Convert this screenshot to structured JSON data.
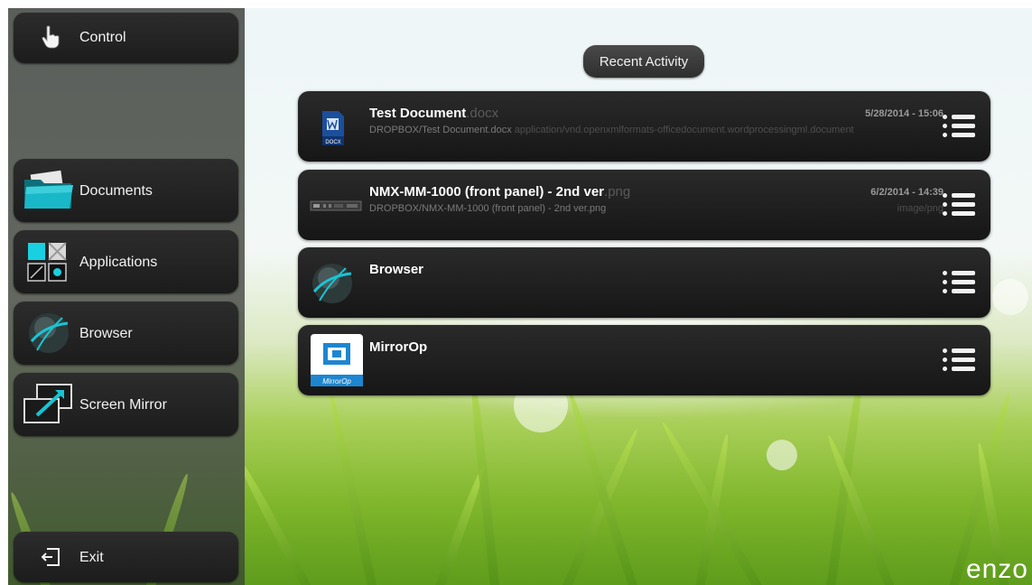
{
  "sidebar": {
    "control": "Control",
    "documents": "Documents",
    "applications": "Applications",
    "browser": "Browser",
    "screen_mirror": "Screen Mirror",
    "exit": "Exit"
  },
  "recent": {
    "title": "Recent Activity",
    "items": [
      {
        "name": "Test Document",
        "ext": ".docx",
        "path": "DROPBOX/Test Document.docx",
        "mime": "application/vnd.openxmlformats-officedocument.wordprocessingml.document",
        "date": "5/28/2014 - 15:06",
        "icon": "docx-file-icon",
        "icon_label": "DOCX"
      },
      {
        "name": "NMX-MM-1000 (front panel) - 2nd ver",
        "ext": ".png",
        "path": "DROPBOX/NMX-MM-1000 (front panel) - 2nd ver.png",
        "mime": "image/png",
        "date": "6/2/2014 - 14:39",
        "icon": "device-panel-thumbnail"
      },
      {
        "name": "Browser",
        "icon": "globe-icon"
      },
      {
        "name": "MirrorOp",
        "icon": "mirrorop-icon",
        "icon_label": "MirrorOp"
      }
    ]
  },
  "brand": "enzo",
  "colors": {
    "accent": "#19b8c8",
    "row_bg": "#1c1c1c",
    "grass": "#7fb62b"
  }
}
